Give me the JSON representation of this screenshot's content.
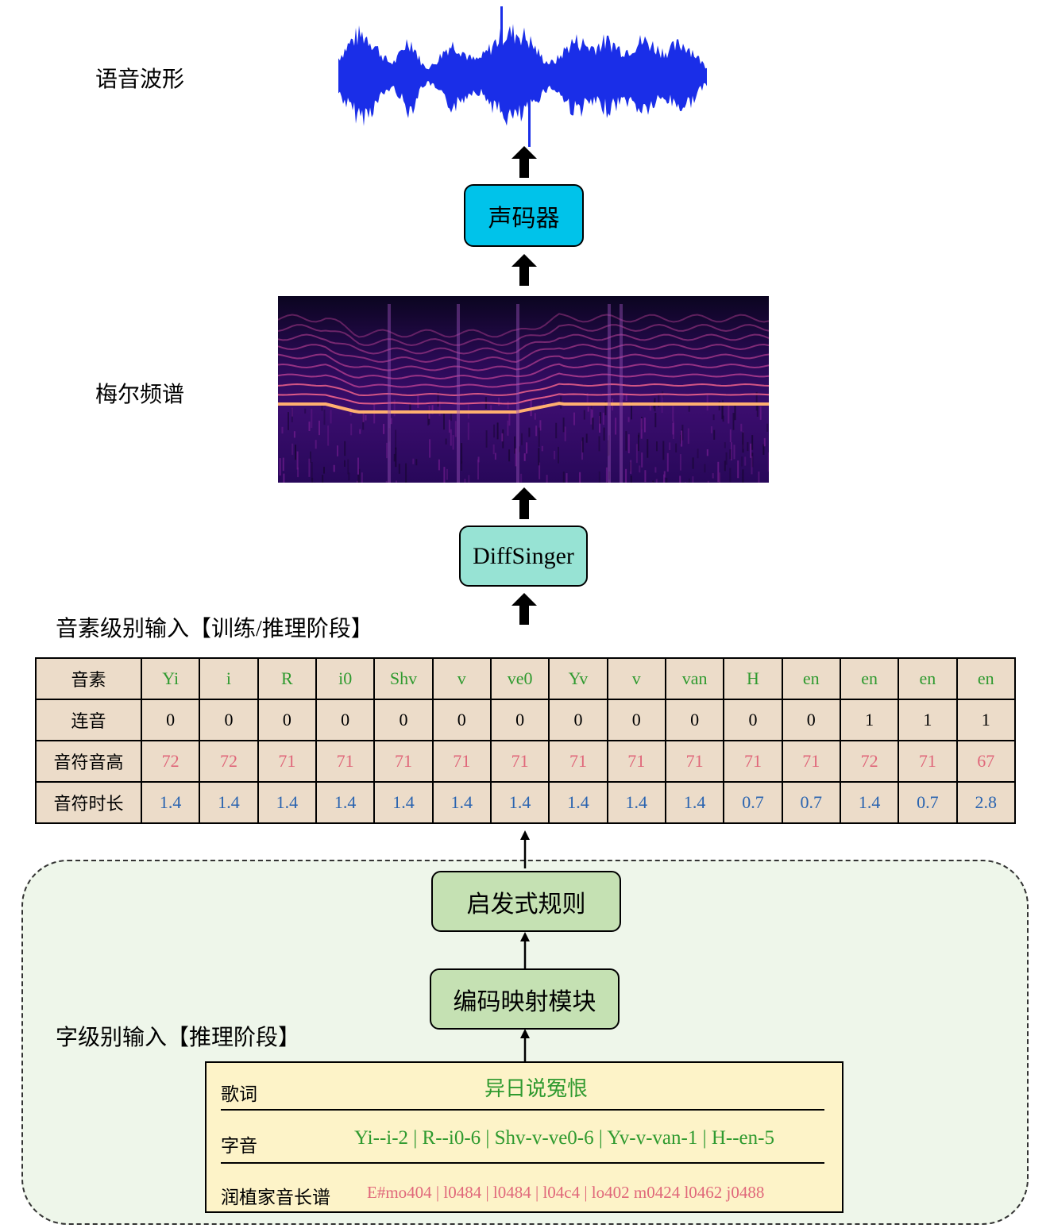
{
  "labels": {
    "waveform": "语音波形",
    "mel": "梅尔频谱",
    "phoneme_input": "音素级别输入【训练/推理阶段】",
    "word_input": "字级别输入【推理阶段】"
  },
  "boxes": {
    "vocoder": "声码器",
    "diffsinger": "DiffSinger",
    "heuristic": "启发式规则",
    "encoder": "编码映射模块"
  },
  "colors": {
    "vocoder": "#00c3ea",
    "diffsinger": "#97e3d4",
    "green_box": "#c5e1b3",
    "table_bg": "#ecdcc9",
    "waveform": "#1a2ee8",
    "yellow": "#fdf3c8"
  },
  "table": {
    "rows": [
      {
        "header": "音素",
        "color": "green",
        "cells": [
          "Yi",
          "i",
          "R",
          "i0",
          "Shv",
          "v",
          "ve0",
          "Yv",
          "v",
          "van",
          "H",
          "en",
          "en",
          "en",
          "en"
        ]
      },
      {
        "header": "连音",
        "color": "black",
        "cells": [
          "0",
          "0",
          "0",
          "0",
          "0",
          "0",
          "0",
          "0",
          "0",
          "0",
          "0",
          "0",
          "1",
          "1",
          "1"
        ]
      },
      {
        "header": "音符音高",
        "color": "red",
        "cells": [
          "72",
          "72",
          "71",
          "71",
          "71",
          "71",
          "71",
          "71",
          "71",
          "71",
          "71",
          "71",
          "72",
          "71",
          "67"
        ]
      },
      {
        "header": "音符时长",
        "color": "blue",
        "cells": [
          "1.4",
          "1.4",
          "1.4",
          "1.4",
          "1.4",
          "1.4",
          "1.4",
          "1.4",
          "1.4",
          "1.4",
          "0.7",
          "0.7",
          "1.4",
          "0.7",
          "2.8"
        ]
      }
    ]
  },
  "word_input": {
    "lyrics_label": "歌词",
    "lyrics": "异日说冤恨",
    "pron_label": "字音",
    "pron": "Yi--i-2 | R--i0-6 | Shv-v-ve0-6 | Yv-v-van-1 | H--en-5",
    "score_label": "润植家音长谱",
    "score": "E#mo404 | l0484 | l0484 | l04c4 | lo402 m0424 l0462 j0488"
  }
}
